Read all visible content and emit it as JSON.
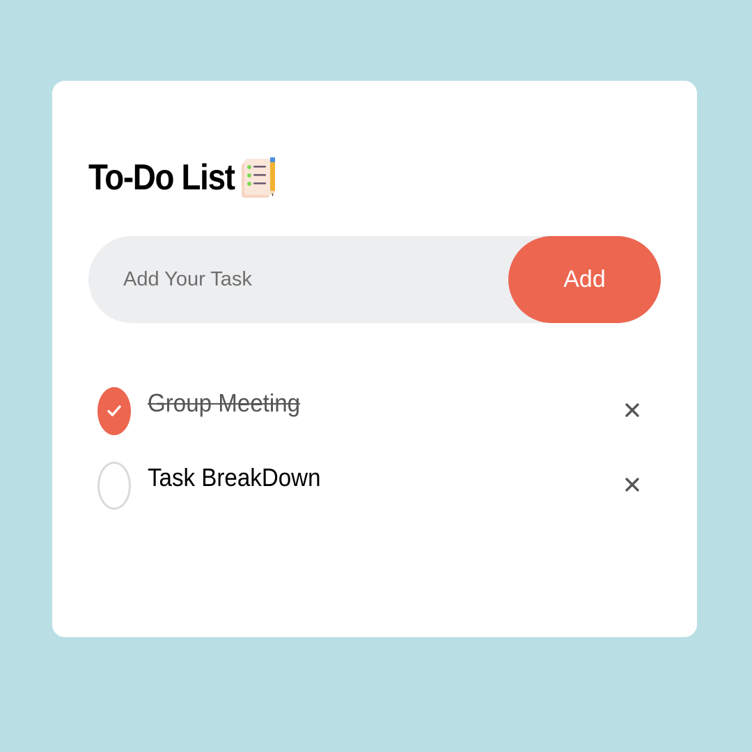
{
  "app": {
    "title": "To-Do List",
    "title_icon": "checklist-icon"
  },
  "input": {
    "placeholder": "Add Your Task",
    "value": ""
  },
  "add_button": {
    "label": "Add"
  },
  "tasks": [
    {
      "label": "Group Meeting",
      "completed": true
    },
    {
      "label": "Task BreakDown",
      "completed": false
    }
  ],
  "icons": {
    "checked": "checkmark-icon",
    "unchecked": "empty-circle-icon",
    "delete": "close-icon"
  },
  "colors": {
    "background": "#b9dfe5",
    "card": "#ffffff",
    "accent": "#ec6650",
    "input_background": "#edeef0"
  }
}
